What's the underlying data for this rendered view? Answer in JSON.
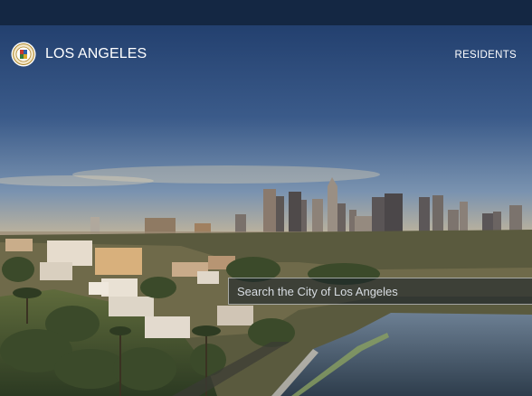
{
  "header": {
    "site_name": "LOS ANGELES",
    "logo_icon": "city-seal-icon",
    "nav": {
      "residents_label": "RESIDENTS"
    }
  },
  "search": {
    "placeholder": "Search the City of Los Angeles",
    "value": ""
  },
  "colors": {
    "topbar": "#142743",
    "sky_top": "#23406f",
    "sky_mid": "#5a7aa0",
    "sky_horizon": "#e0b98a",
    "text": "#ffffff"
  }
}
